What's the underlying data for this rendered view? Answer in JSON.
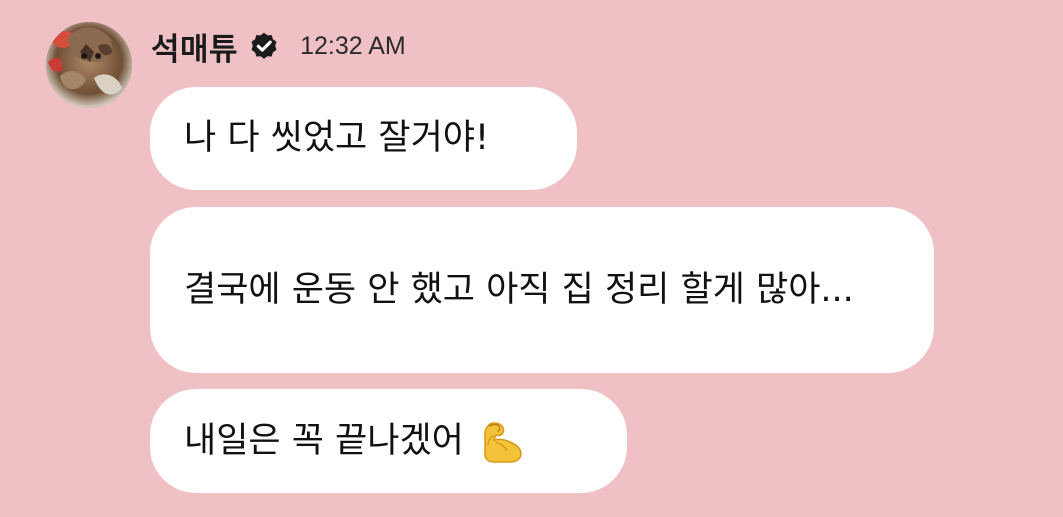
{
  "chat": {
    "sender_name": "석매튜",
    "timestamp": "12:32 AM",
    "messages": [
      "나 다 씻었고 잘거야!",
      "결국에 운동 안 했고 아직 집 정리 할게 많아...",
      "내일은 꼭 끝나겠어"
    ],
    "emoji_icon": "flexed-biceps-icon",
    "verified_icon": "verified-badge-icon",
    "colors": {
      "background": "#efc0c4",
      "bubble": "#ffffff",
      "text": "#111111",
      "emoji": "#f2c23b"
    }
  }
}
